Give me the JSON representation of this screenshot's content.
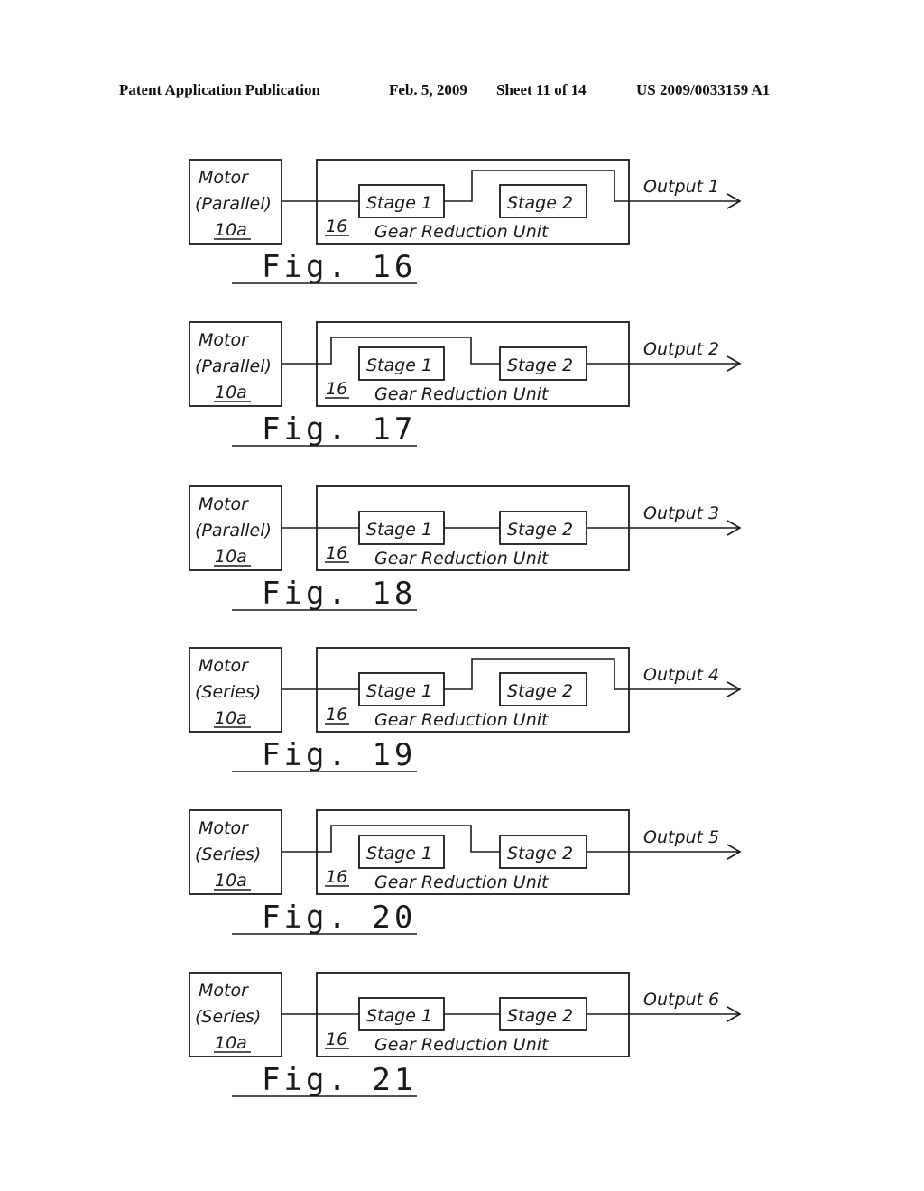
{
  "header": {
    "publication": "Patent Application Publication",
    "date": "Feb. 5, 2009",
    "sheet": "Sheet 11 of 14",
    "number": "US 2009/0033159 A1"
  },
  "common": {
    "stage1": "Stage 1",
    "stage2": "Stage 2",
    "unit_ref": "16",
    "unit_label": "Gear Reduction Unit",
    "motor_label": "Motor",
    "motor_ref": "10a"
  },
  "figures": [
    {
      "fig_label": "Fig. 16",
      "motor_type": "(Parallel)",
      "output": "Output 1",
      "routing": "stage1-bypass-stage2"
    },
    {
      "fig_label": "Fig. 17",
      "motor_type": "(Parallel)",
      "output": "Output 2",
      "routing": "bypass-stage1-to-stage2"
    },
    {
      "fig_label": "Fig. 18",
      "motor_type": "(Parallel)",
      "output": "Output 3",
      "routing": "stage1-then-stage2"
    },
    {
      "fig_label": "Fig. 19",
      "motor_type": "(Series)",
      "output": "Output 4",
      "routing": "stage1-bypass-stage2"
    },
    {
      "fig_label": "Fig. 20",
      "motor_type": "(Series)",
      "output": "Output 5",
      "routing": "bypass-stage1-to-stage2"
    },
    {
      "fig_label": "Fig. 21",
      "motor_type": "(Series)",
      "output": "Output 6",
      "routing": "stage1-then-stage2"
    }
  ]
}
